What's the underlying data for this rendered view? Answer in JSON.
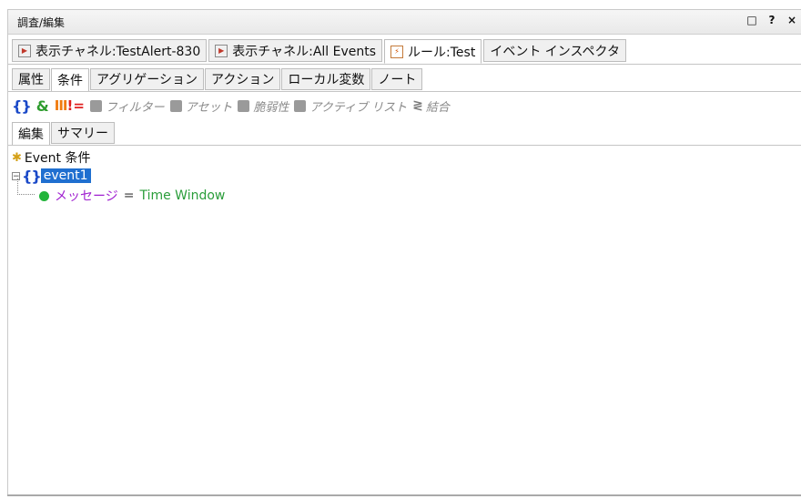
{
  "window": {
    "title": "調査/編集",
    "buttons": {
      "float": "□",
      "help": "?",
      "close": "×"
    }
  },
  "main_tabs": [
    {
      "label": "表示チャネル:TestAlert-830",
      "icon": "play-icon",
      "active": false
    },
    {
      "label": "表示チャネル:All Events",
      "icon": "play-icon",
      "active": false
    },
    {
      "label": "ルール:Test",
      "icon": "bolt-icon",
      "active": true
    },
    {
      "label": "イベント インスペクタ",
      "icon": "",
      "active": false
    }
  ],
  "sub_tabs": [
    {
      "label": "属性",
      "active": false
    },
    {
      "label": "条件",
      "active": true
    },
    {
      "label": "アグリゲーション",
      "active": false
    },
    {
      "label": "アクション",
      "active": false
    },
    {
      "label": "ローカル変数",
      "active": false
    },
    {
      "label": "ノート",
      "active": false
    }
  ],
  "toolbar": {
    "braces": "{}",
    "and": "&",
    "bars": "III",
    "neq": "!=",
    "filter": "フィルター",
    "asset": "アセット",
    "vulnerability": "脆弱性",
    "active_list": "アクティブ リスト",
    "join": "結合"
  },
  "edit_tabs": [
    {
      "label": "編集",
      "active": true
    },
    {
      "label": "サマリー",
      "active": false
    }
  ],
  "tree": {
    "root": "Event 条件",
    "node": "event1",
    "condition": {
      "field": "メッセージ",
      "op": "=",
      "value": "Time Window"
    }
  },
  "colors": {
    "selection": "#1f6fd0",
    "field": "#a020d0",
    "value": "#2a9d3a",
    "braces": "#1a49c8"
  }
}
